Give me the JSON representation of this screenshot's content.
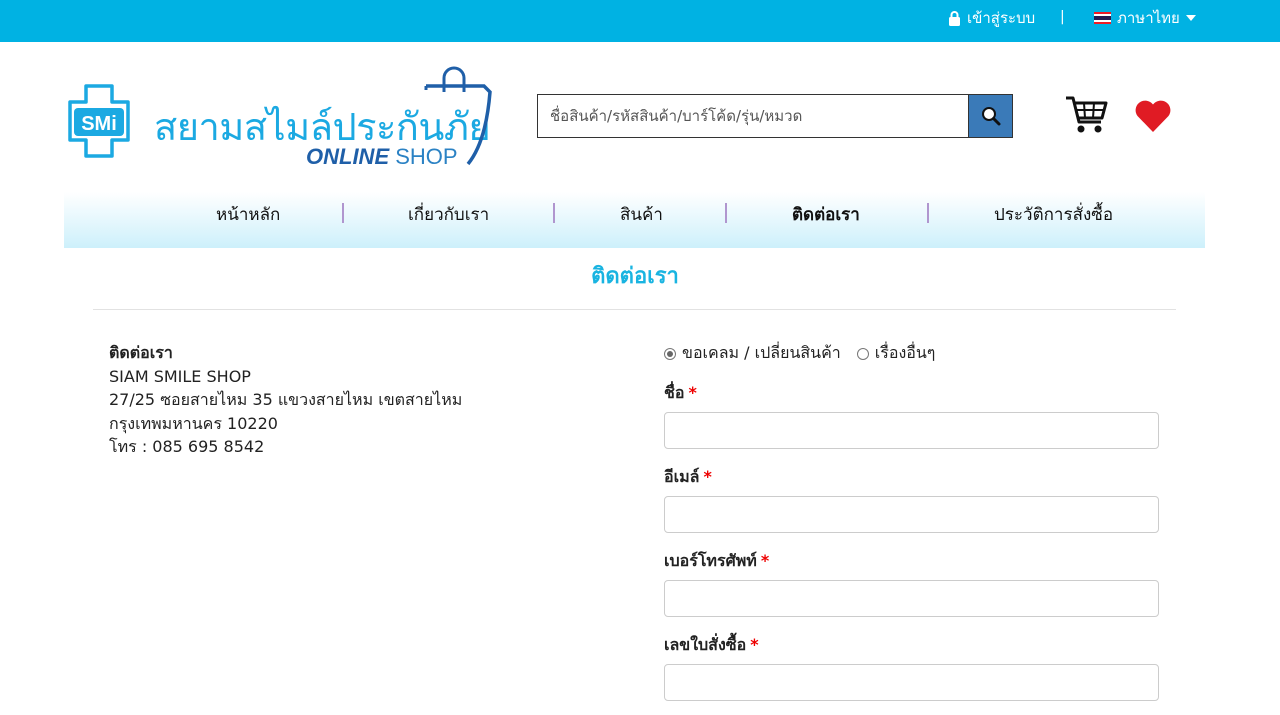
{
  "topbar": {
    "login_label": "เข้าสู่ระบบ",
    "separator": "|",
    "language_label": "ภาษาไทย",
    "bg_color": "#00b2e3"
  },
  "header": {
    "logo": {
      "badge_text": "SMi",
      "brand_text": "สยามสไมล์ประกันภัย",
      "online": "ONLINE",
      "shop": "SHOP"
    },
    "search": {
      "placeholder": "ชื่อสินค้า/รหัสสินค้า/บาร์โค้ด/รุ่น/หมวด",
      "value": ""
    }
  },
  "nav": {
    "items": [
      {
        "label": "หน้าหลัก"
      },
      {
        "label": "เกี่ยวกับเรา"
      },
      {
        "label": "สินค้า"
      },
      {
        "label": "ติดต่อเรา",
        "active": true
      },
      {
        "label": "ประวัติการสั่งซื้อ"
      }
    ]
  },
  "page": {
    "title": "ติดต่อเรา"
  },
  "contact": {
    "heading": "ติดต่อเรา",
    "company": "SIAM SMILE SHOP",
    "address1": "27/25 ซอยสายไหม 35 แขวงสายไหม เขตสายไหม",
    "address2": "กรุงเทพมหานคร 10220",
    "phone": "โทร : 085 695 8542"
  },
  "form": {
    "radio_options": [
      {
        "label": "ขอเคลม / เปลี่ยนสินค้า",
        "checked": true
      },
      {
        "label": "เรื่องอื่นๆ",
        "checked": false
      }
    ],
    "fields": [
      {
        "label": "ชื่อ",
        "required": "*",
        "value": ""
      },
      {
        "label": "อีเมล์",
        "required": "*",
        "value": ""
      },
      {
        "label": "เบอร์โทรศัพท์",
        "required": "*",
        "value": ""
      },
      {
        "label": "เลขใบสั่งซื้อ",
        "required": "*",
        "value": ""
      }
    ]
  },
  "colors": {
    "accent": "#19b4e1",
    "nav_gradient_end": "#cdf0fb",
    "search_button": "#3a7ab8",
    "heart": "#e01b24",
    "required": "#ee0000"
  },
  "icons": [
    "lock-icon",
    "thai-flag-icon",
    "caret-down-icon",
    "search-icon",
    "cart-icon",
    "heart-icon"
  ]
}
